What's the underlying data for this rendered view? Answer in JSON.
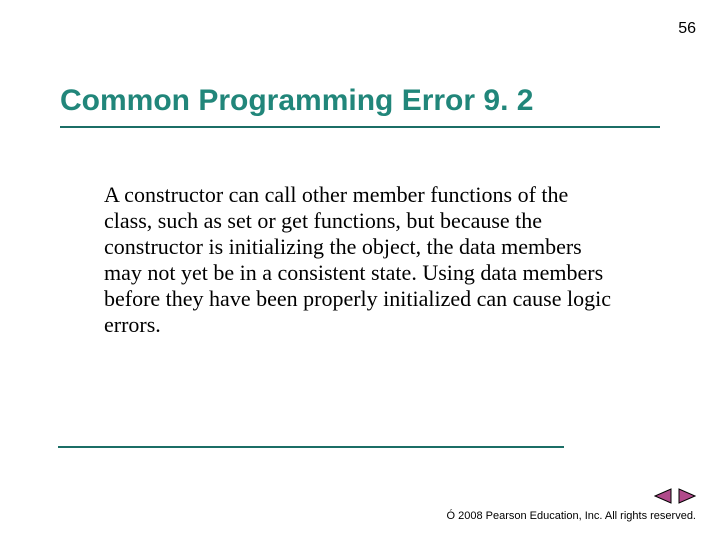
{
  "page_number": "56",
  "title": "Common Programming Error 9. 2",
  "body": "A constructor can call other member functions of the class, such as set or get functions, but because the constructor is initializing the object, the data members may not yet be in a consistent state. Using data members before they have been properly initialized can cause logic errors.",
  "copyright": "Ó 2008 Pearson Education, Inc.  All rights reserved.",
  "colors": {
    "accent": "#21867a",
    "rule": "#1b6e66",
    "nav_fill": "#b04a8a",
    "nav_stroke": "#000000"
  },
  "nav": {
    "prev": "previous slide",
    "next": "next slide"
  }
}
